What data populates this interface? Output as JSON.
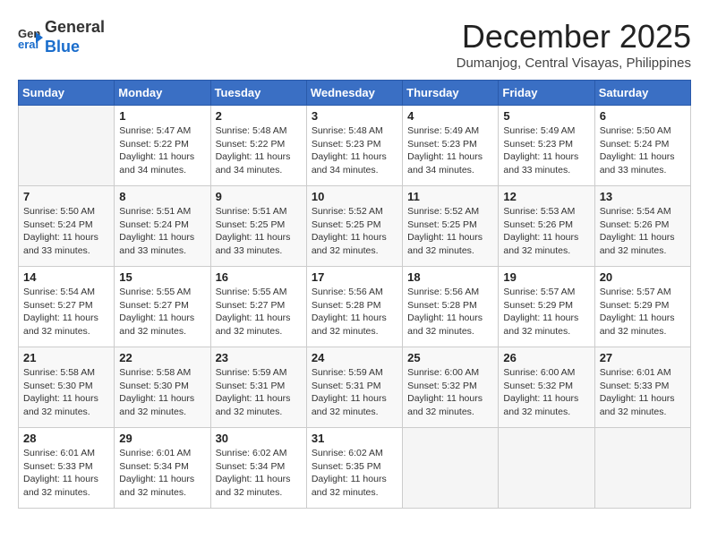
{
  "logo": {
    "line1": "General",
    "line2": "Blue"
  },
  "title": "December 2025",
  "subtitle": "Dumanjog, Central Visayas, Philippines",
  "weekdays": [
    "Sunday",
    "Monday",
    "Tuesday",
    "Wednesday",
    "Thursday",
    "Friday",
    "Saturday"
  ],
  "weeks": [
    [
      {
        "num": "",
        "sunrise": "",
        "sunset": "",
        "daylight": ""
      },
      {
        "num": "1",
        "sunrise": "Sunrise: 5:47 AM",
        "sunset": "Sunset: 5:22 PM",
        "daylight": "Daylight: 11 hours and 34 minutes."
      },
      {
        "num": "2",
        "sunrise": "Sunrise: 5:48 AM",
        "sunset": "Sunset: 5:22 PM",
        "daylight": "Daylight: 11 hours and 34 minutes."
      },
      {
        "num": "3",
        "sunrise": "Sunrise: 5:48 AM",
        "sunset": "Sunset: 5:23 PM",
        "daylight": "Daylight: 11 hours and 34 minutes."
      },
      {
        "num": "4",
        "sunrise": "Sunrise: 5:49 AM",
        "sunset": "Sunset: 5:23 PM",
        "daylight": "Daylight: 11 hours and 34 minutes."
      },
      {
        "num": "5",
        "sunrise": "Sunrise: 5:49 AM",
        "sunset": "Sunset: 5:23 PM",
        "daylight": "Daylight: 11 hours and 33 minutes."
      },
      {
        "num": "6",
        "sunrise": "Sunrise: 5:50 AM",
        "sunset": "Sunset: 5:24 PM",
        "daylight": "Daylight: 11 hours and 33 minutes."
      }
    ],
    [
      {
        "num": "7",
        "sunrise": "Sunrise: 5:50 AM",
        "sunset": "Sunset: 5:24 PM",
        "daylight": "Daylight: 11 hours and 33 minutes."
      },
      {
        "num": "8",
        "sunrise": "Sunrise: 5:51 AM",
        "sunset": "Sunset: 5:24 PM",
        "daylight": "Daylight: 11 hours and 33 minutes."
      },
      {
        "num": "9",
        "sunrise": "Sunrise: 5:51 AM",
        "sunset": "Sunset: 5:25 PM",
        "daylight": "Daylight: 11 hours and 33 minutes."
      },
      {
        "num": "10",
        "sunrise": "Sunrise: 5:52 AM",
        "sunset": "Sunset: 5:25 PM",
        "daylight": "Daylight: 11 hours and 32 minutes."
      },
      {
        "num": "11",
        "sunrise": "Sunrise: 5:52 AM",
        "sunset": "Sunset: 5:25 PM",
        "daylight": "Daylight: 11 hours and 32 minutes."
      },
      {
        "num": "12",
        "sunrise": "Sunrise: 5:53 AM",
        "sunset": "Sunset: 5:26 PM",
        "daylight": "Daylight: 11 hours and 32 minutes."
      },
      {
        "num": "13",
        "sunrise": "Sunrise: 5:54 AM",
        "sunset": "Sunset: 5:26 PM",
        "daylight": "Daylight: 11 hours and 32 minutes."
      }
    ],
    [
      {
        "num": "14",
        "sunrise": "Sunrise: 5:54 AM",
        "sunset": "Sunset: 5:27 PM",
        "daylight": "Daylight: 11 hours and 32 minutes."
      },
      {
        "num": "15",
        "sunrise": "Sunrise: 5:55 AM",
        "sunset": "Sunset: 5:27 PM",
        "daylight": "Daylight: 11 hours and 32 minutes."
      },
      {
        "num": "16",
        "sunrise": "Sunrise: 5:55 AM",
        "sunset": "Sunset: 5:27 PM",
        "daylight": "Daylight: 11 hours and 32 minutes."
      },
      {
        "num": "17",
        "sunrise": "Sunrise: 5:56 AM",
        "sunset": "Sunset: 5:28 PM",
        "daylight": "Daylight: 11 hours and 32 minutes."
      },
      {
        "num": "18",
        "sunrise": "Sunrise: 5:56 AM",
        "sunset": "Sunset: 5:28 PM",
        "daylight": "Daylight: 11 hours and 32 minutes."
      },
      {
        "num": "19",
        "sunrise": "Sunrise: 5:57 AM",
        "sunset": "Sunset: 5:29 PM",
        "daylight": "Daylight: 11 hours and 32 minutes."
      },
      {
        "num": "20",
        "sunrise": "Sunrise: 5:57 AM",
        "sunset": "Sunset: 5:29 PM",
        "daylight": "Daylight: 11 hours and 32 minutes."
      }
    ],
    [
      {
        "num": "21",
        "sunrise": "Sunrise: 5:58 AM",
        "sunset": "Sunset: 5:30 PM",
        "daylight": "Daylight: 11 hours and 32 minutes."
      },
      {
        "num": "22",
        "sunrise": "Sunrise: 5:58 AM",
        "sunset": "Sunset: 5:30 PM",
        "daylight": "Daylight: 11 hours and 32 minutes."
      },
      {
        "num": "23",
        "sunrise": "Sunrise: 5:59 AM",
        "sunset": "Sunset: 5:31 PM",
        "daylight": "Daylight: 11 hours and 32 minutes."
      },
      {
        "num": "24",
        "sunrise": "Sunrise: 5:59 AM",
        "sunset": "Sunset: 5:31 PM",
        "daylight": "Daylight: 11 hours and 32 minutes."
      },
      {
        "num": "25",
        "sunrise": "Sunrise: 6:00 AM",
        "sunset": "Sunset: 5:32 PM",
        "daylight": "Daylight: 11 hours and 32 minutes."
      },
      {
        "num": "26",
        "sunrise": "Sunrise: 6:00 AM",
        "sunset": "Sunset: 5:32 PM",
        "daylight": "Daylight: 11 hours and 32 minutes."
      },
      {
        "num": "27",
        "sunrise": "Sunrise: 6:01 AM",
        "sunset": "Sunset: 5:33 PM",
        "daylight": "Daylight: 11 hours and 32 minutes."
      }
    ],
    [
      {
        "num": "28",
        "sunrise": "Sunrise: 6:01 AM",
        "sunset": "Sunset: 5:33 PM",
        "daylight": "Daylight: 11 hours and 32 minutes."
      },
      {
        "num": "29",
        "sunrise": "Sunrise: 6:01 AM",
        "sunset": "Sunset: 5:34 PM",
        "daylight": "Daylight: 11 hours and 32 minutes."
      },
      {
        "num": "30",
        "sunrise": "Sunrise: 6:02 AM",
        "sunset": "Sunset: 5:34 PM",
        "daylight": "Daylight: 11 hours and 32 minutes."
      },
      {
        "num": "31",
        "sunrise": "Sunrise: 6:02 AM",
        "sunset": "Sunset: 5:35 PM",
        "daylight": "Daylight: 11 hours and 32 minutes."
      },
      {
        "num": "",
        "sunrise": "",
        "sunset": "",
        "daylight": ""
      },
      {
        "num": "",
        "sunrise": "",
        "sunset": "",
        "daylight": ""
      },
      {
        "num": "",
        "sunrise": "",
        "sunset": "",
        "daylight": ""
      }
    ]
  ]
}
